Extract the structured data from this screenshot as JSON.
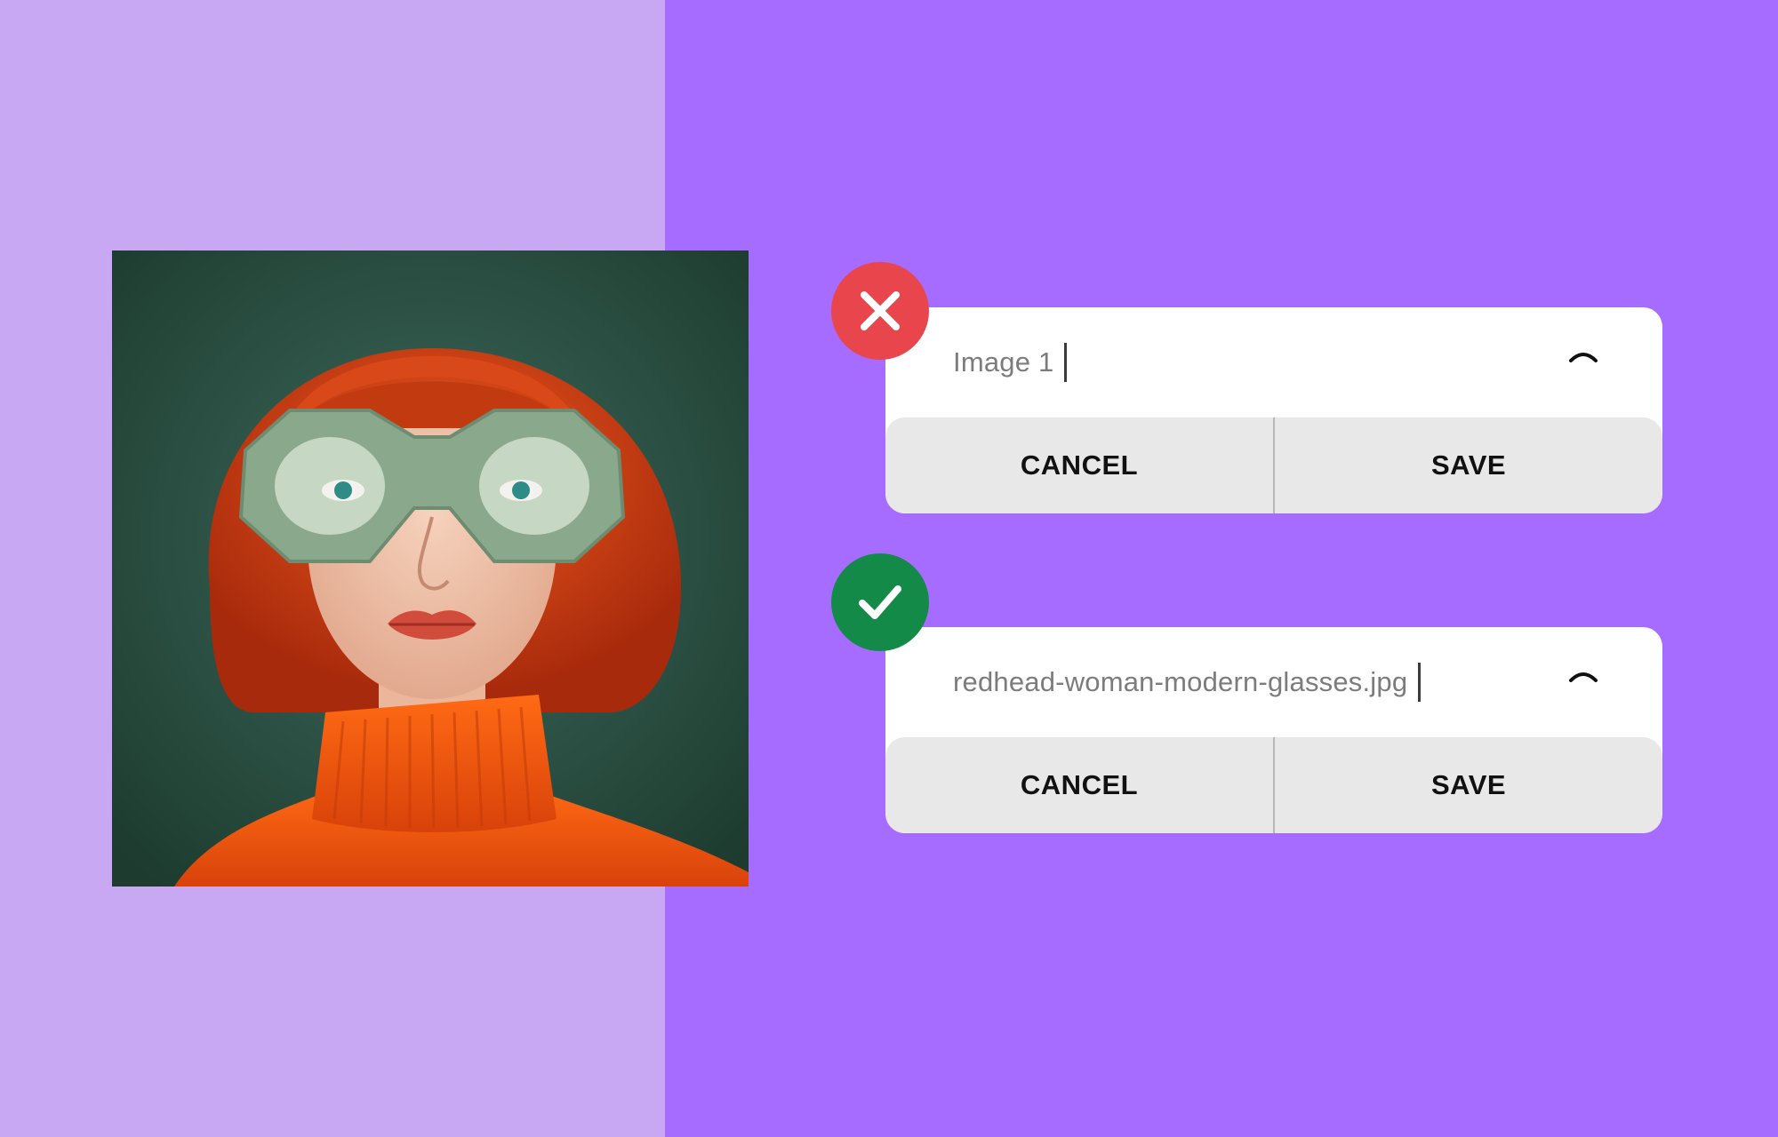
{
  "colors": {
    "background_left": "#c8a8f2",
    "background_right": "#a66bff",
    "error_badge": "#e8464c",
    "success_badge": "#148a48",
    "card_background": "#ffffff",
    "button_row_background": "#e8e8e8"
  },
  "image": {
    "alt": "Portrait of a red-haired woman wearing oversized green glasses and an orange turtleneck"
  },
  "bad_example": {
    "status_icon": "close-icon",
    "filename_value": "Image 1",
    "toggle_icon": "chevron-up-icon",
    "cancel_label": "CANCEL",
    "save_label": "SAVE"
  },
  "good_example": {
    "status_icon": "check-icon",
    "filename_value": "redhead-woman-modern-glasses.jpg",
    "toggle_icon": "chevron-up-icon",
    "cancel_label": "CANCEL",
    "save_label": "SAVE"
  }
}
